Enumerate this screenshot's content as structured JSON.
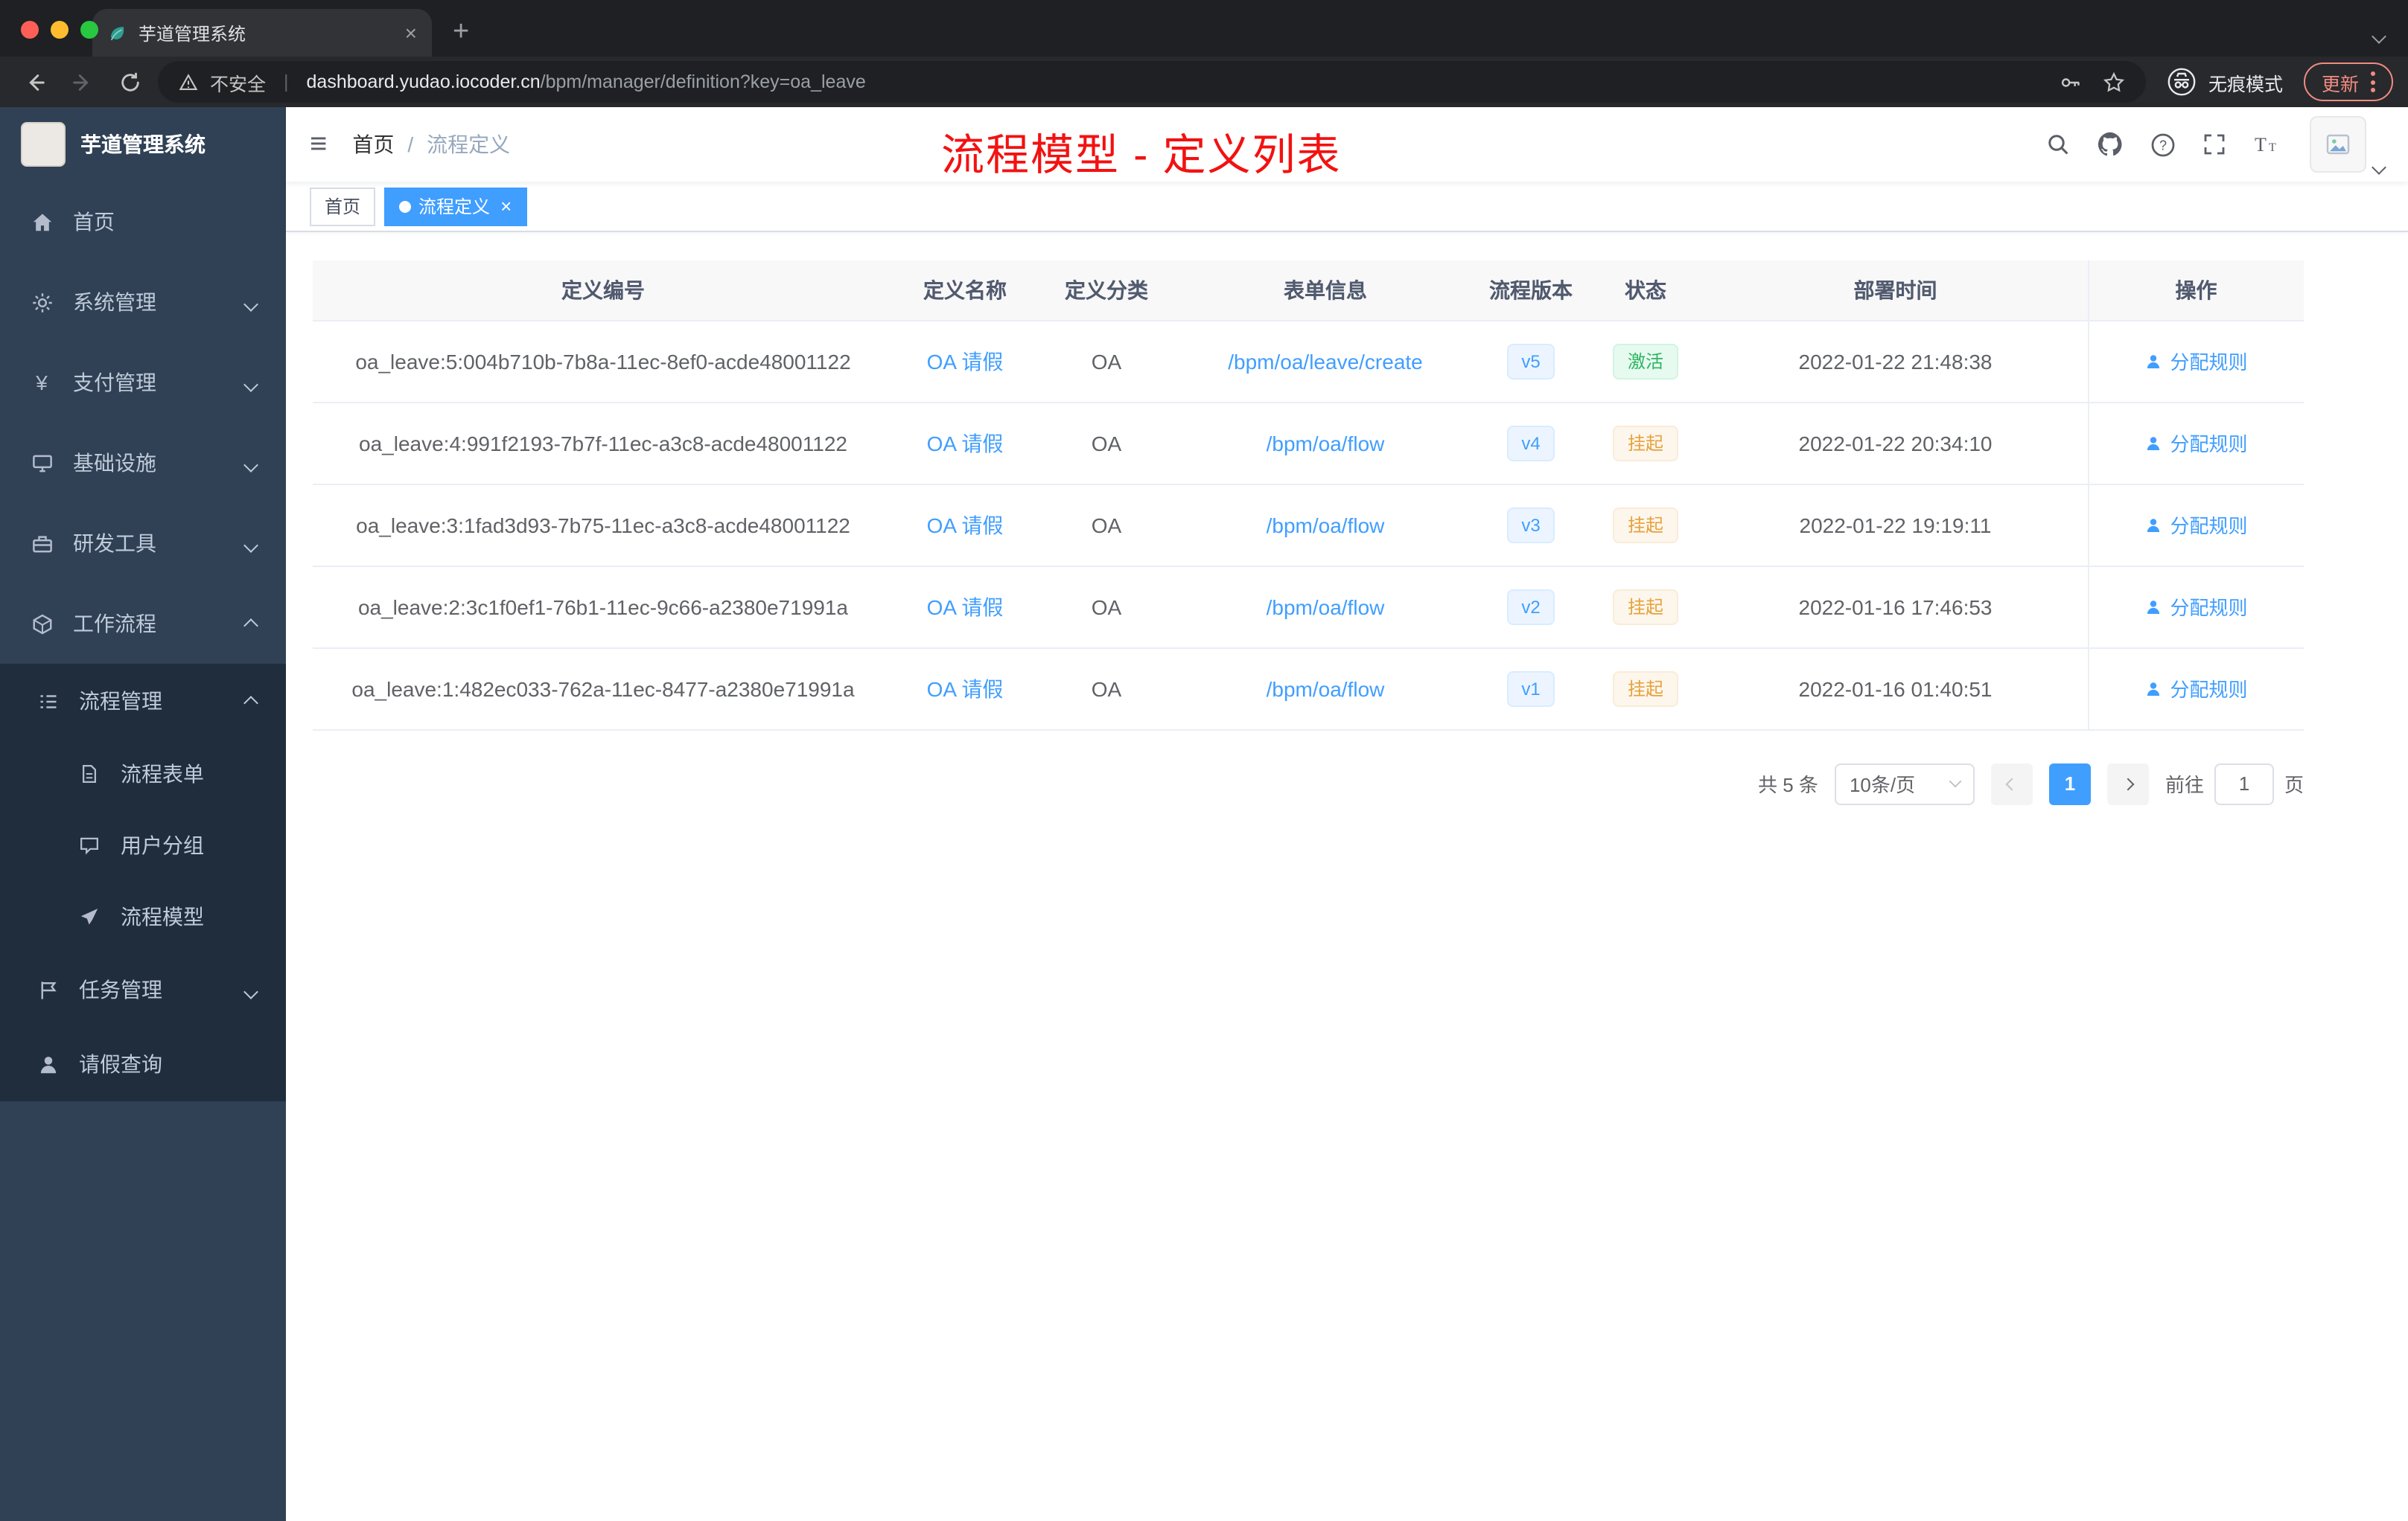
{
  "colors": {
    "primary": "#409eff",
    "success_text": "#2cb561",
    "warning_text": "#e6a23c",
    "annotation_red": "#f31111",
    "sidebar_bg": "#304156",
    "submenu_bg": "#1f2d3d",
    "browser_dark": "#1f2023"
  },
  "icons": {
    "close": "×",
    "plus": "+",
    "hamburger": "≡",
    "payment_yen": "¥",
    "breadcrumb_sep": "/"
  },
  "browser": {
    "tab_title": "芋道管理系统",
    "security_label": "不安全",
    "url_domain": "dashboard.yudao.iocoder.cn",
    "url_path": "/bpm/manager/definition?key=oa_leave",
    "incognito_label": "无痕模式",
    "update_label": "更新"
  },
  "sidebar": {
    "logo_title": "芋道管理系统",
    "items": {
      "home": "首页",
      "system": "系统管理",
      "payment": "支付管理",
      "infra": "基础设施",
      "devtools": "研发工具",
      "workflow": "工作流程",
      "process_mgmt": "流程管理",
      "process_form": "流程表单",
      "user_group": "用户分组",
      "process_model": "流程模型",
      "task_mgmt": "任务管理",
      "leave_query": "请假查询"
    }
  },
  "header": {
    "breadcrumb_home": "首页",
    "breadcrumb_current": "流程定义",
    "annotation_title": "流程模型 - 定义列表"
  },
  "tags": {
    "home": "首页",
    "active": "流程定义"
  },
  "table": {
    "headers": [
      "定义编号",
      "定义名称",
      "定义分类",
      "表单信息",
      "流程版本",
      "状态",
      "部署时间",
      "操作"
    ],
    "rows": [
      {
        "id": "oa_leave:5:004b710b-7b8a-11ec-8ef0-acde48001122",
        "name": "OA 请假",
        "category": "OA",
        "form": "/bpm/oa/leave/create",
        "version": "v5",
        "status": "激活",
        "status_type": "success",
        "time": "2022-01-22 21:48:38",
        "action": "分配规则"
      },
      {
        "id": "oa_leave:4:991f2193-7b7f-11ec-a3c8-acde48001122",
        "name": "OA 请假",
        "category": "OA",
        "form": "/bpm/oa/flow",
        "version": "v4",
        "status": "挂起",
        "status_type": "warning",
        "time": "2022-01-22 20:34:10",
        "action": "分配规则"
      },
      {
        "id": "oa_leave:3:1fad3d93-7b75-11ec-a3c8-acde48001122",
        "name": "OA 请假",
        "category": "OA",
        "form": "/bpm/oa/flow",
        "version": "v3",
        "status": "挂起",
        "status_type": "warning",
        "time": "2022-01-22 19:19:11",
        "action": "分配规则"
      },
      {
        "id": "oa_leave:2:3c1f0ef1-76b1-11ec-9c66-a2380e71991a",
        "name": "OA 请假",
        "category": "OA",
        "form": "/bpm/oa/flow",
        "version": "v2",
        "status": "挂起",
        "status_type": "warning",
        "time": "2022-01-16 17:46:53",
        "action": "分配规则"
      },
      {
        "id": "oa_leave:1:482ec033-762a-11ec-8477-a2380e71991a",
        "name": "OA 请假",
        "category": "OA",
        "form": "/bpm/oa/flow",
        "version": "v1",
        "status": "挂起",
        "status_type": "warning",
        "time": "2022-01-16 01:40:51",
        "action": "分配规则"
      }
    ]
  },
  "pagination": {
    "total": "共 5 条",
    "page_size": "10条/页",
    "current": "1",
    "goto_label": "前往",
    "goto_value": "1",
    "page_unit": "页"
  }
}
